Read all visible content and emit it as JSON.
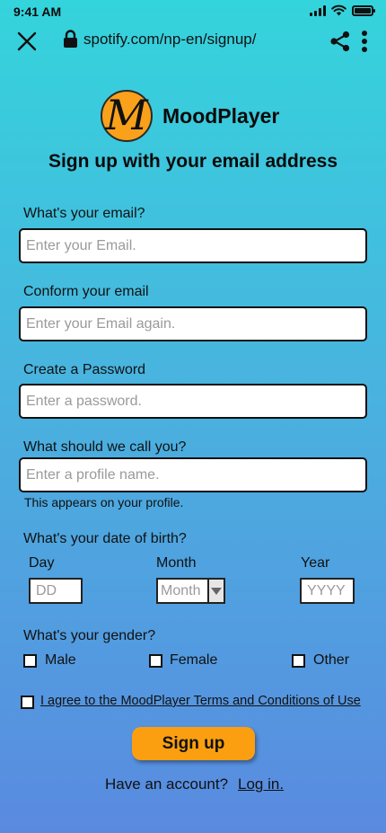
{
  "status_bar": {
    "time": "9:41 AM"
  },
  "browser": {
    "url": "spotify.com/np-en/signup/"
  },
  "brand": {
    "logo_letter": "M",
    "name": "MoodPlayer"
  },
  "headline": "Sign up with your email address",
  "form": {
    "email": {
      "label": "What's your email?",
      "placeholder": "Enter your Email.",
      "value": ""
    },
    "confirm_email": {
      "label": "Conform your email",
      "placeholder": "Enter your Email again.",
      "value": ""
    },
    "password": {
      "label": "Create a Password",
      "placeholder": "Enter a password.",
      "value": ""
    },
    "profile_name": {
      "label": "What should we call you?",
      "placeholder": "Enter a profile name.",
      "value": "",
      "helper": "This appears on your profile."
    },
    "dob": {
      "label": "What's your date of birth?",
      "day_label": "Day",
      "day_placeholder": "DD",
      "month_label": "Month",
      "month_placeholder": "Month",
      "year_label": "Year",
      "year_placeholder": "YYYY"
    },
    "gender": {
      "label": "What's your gender?",
      "options": [
        "Male",
        "Female",
        "Other"
      ]
    },
    "terms": "I agree to the MoodPlayer Terms and Conditions of Use",
    "submit_label": "Sign up",
    "have_account": "Have an account?",
    "login_label": "Log in."
  },
  "colors": {
    "accent": "#fb9f10",
    "gradient_top": "#34d4dc",
    "gradient_bottom": "#5a8ae0"
  }
}
